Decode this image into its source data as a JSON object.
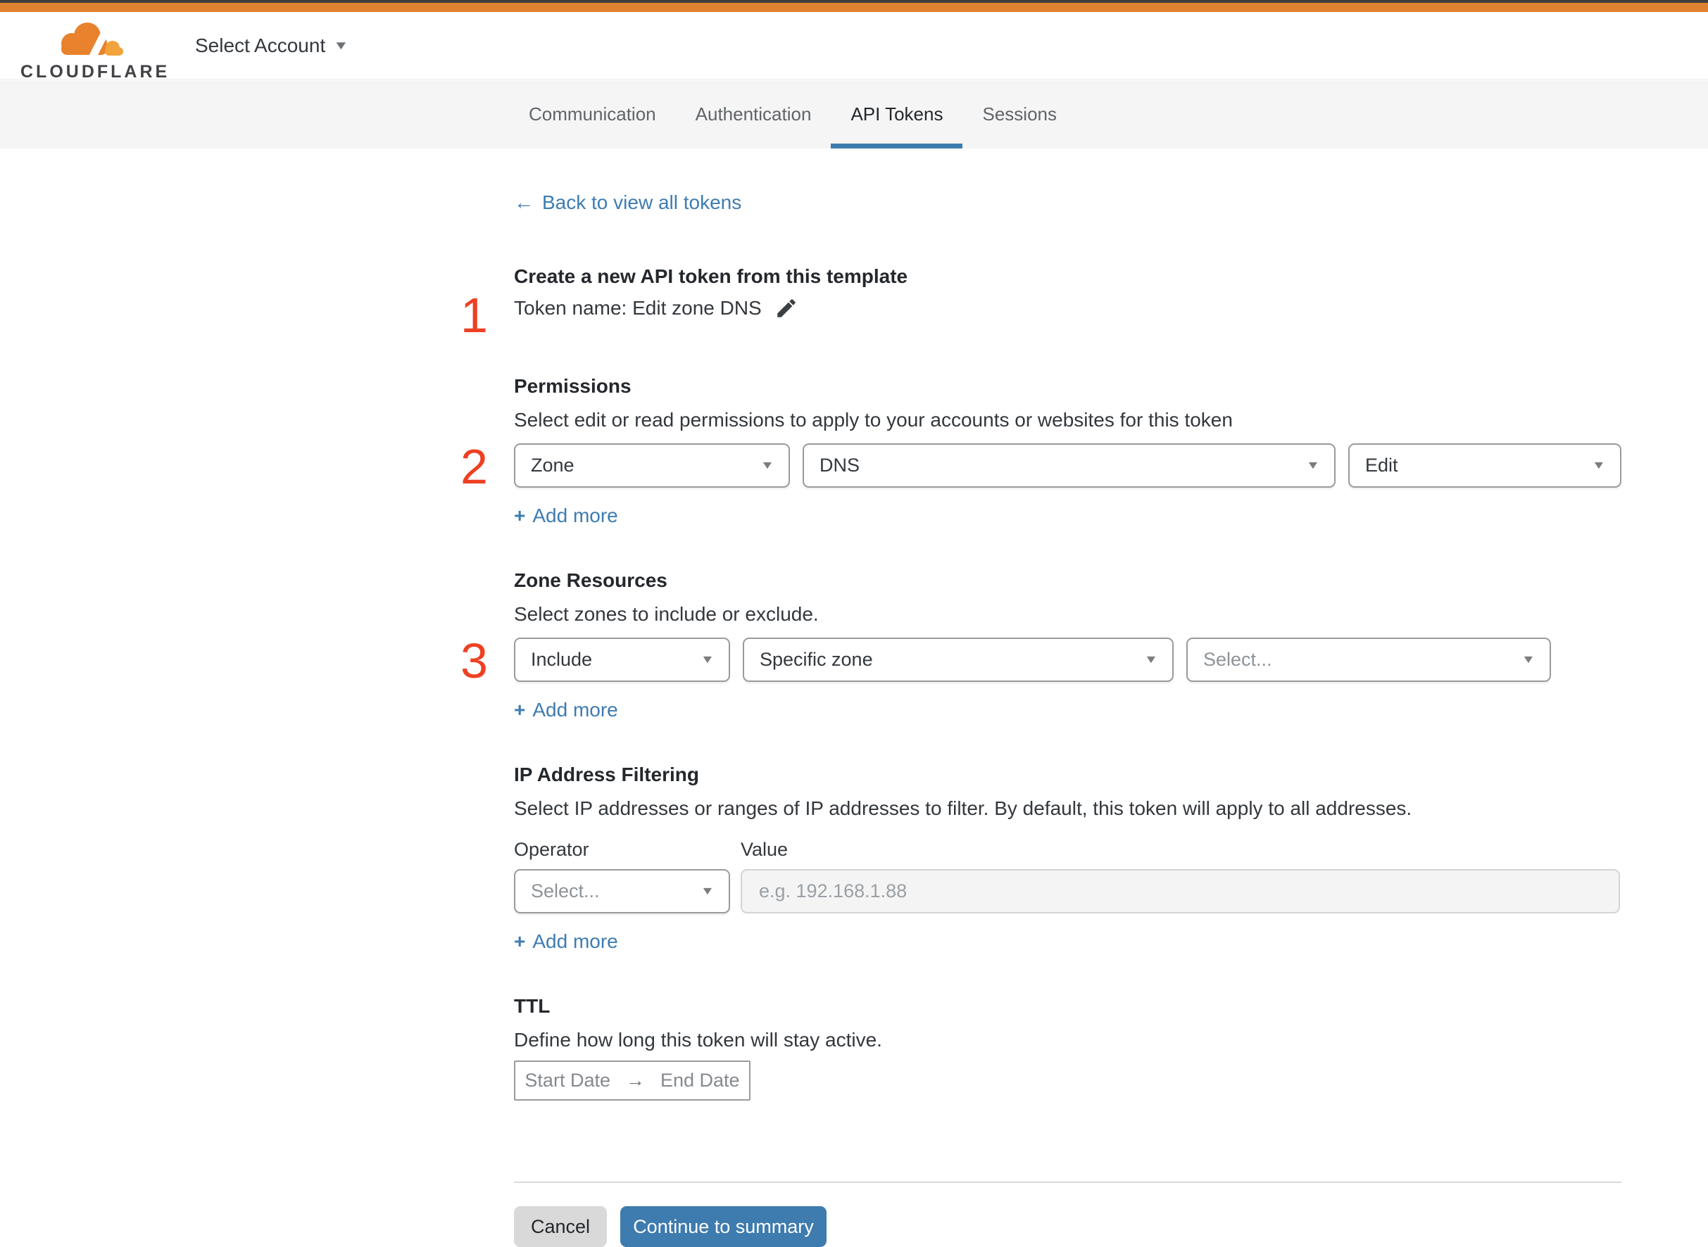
{
  "header": {
    "logo_text": "CLOUDFLARE",
    "account_selector_label": "Select Account"
  },
  "tabs": [
    {
      "label": "Communication",
      "active": false
    },
    {
      "label": "Authentication",
      "active": false
    },
    {
      "label": "API Tokens",
      "active": true
    },
    {
      "label": "Sessions",
      "active": false
    }
  ],
  "back_link": {
    "arrow": "←",
    "label": "Back to view all tokens"
  },
  "token_section": {
    "step": "1",
    "heading": "Create a new API token from this template",
    "token_name": "Token name: Edit zone DNS"
  },
  "permissions": {
    "step": "2",
    "heading": "Permissions",
    "description": "Select edit or read permissions to apply to your accounts or websites for this token",
    "dropdowns": [
      {
        "value": "Zone"
      },
      {
        "value": "DNS"
      },
      {
        "value": "Edit"
      }
    ],
    "add_more": "Add more"
  },
  "zone_resources": {
    "step": "3",
    "heading": "Zone Resources",
    "description": "Select zones to include or exclude.",
    "dropdowns": [
      {
        "value": "Include"
      },
      {
        "value": "Specific zone"
      },
      {
        "value": "Select..."
      }
    ],
    "add_more": "Add more"
  },
  "ip_filtering": {
    "heading": "IP Address Filtering",
    "description": "Select IP addresses or ranges of IP addresses to filter. By default, this token will apply to all addresses.",
    "operator_label": "Operator",
    "value_label": "Value",
    "operator_value": "Select...",
    "value_placeholder": "e.g. 192.168.1.88",
    "add_more": "Add more"
  },
  "ttl": {
    "heading": "TTL",
    "description": "Define how long this token will stay active.",
    "start_label": "Start Date",
    "range_arrow": "→",
    "end_label": "End Date"
  },
  "footer": {
    "cancel_label": "Cancel",
    "continue_label": "Continue to summary"
  },
  "icons": {
    "plus": "+",
    "caret_down": "▼"
  },
  "colors": {
    "accent_blue": "#3e7cb1",
    "button_blue": "#3e7bae",
    "top_orange": "#e0822f",
    "step_red": "#ee4023"
  }
}
